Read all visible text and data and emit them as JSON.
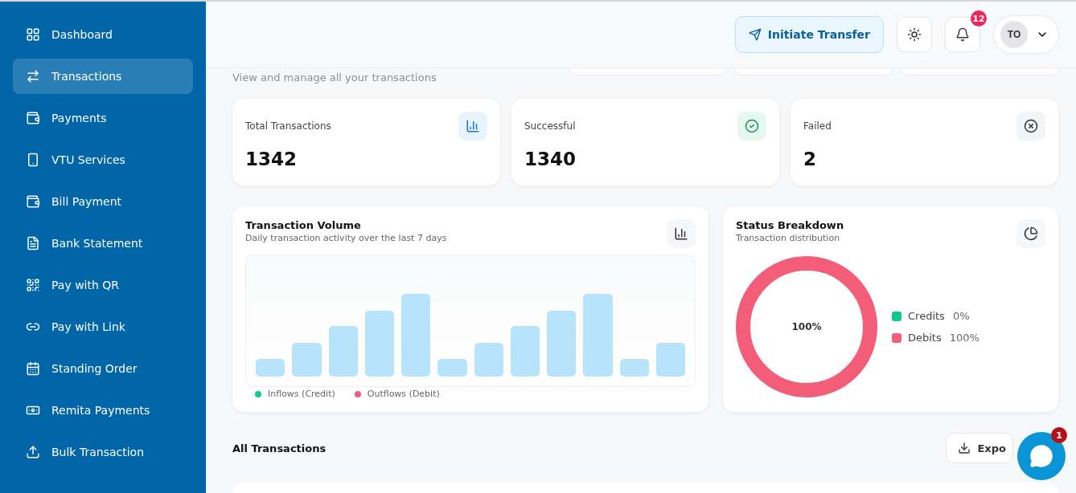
{
  "sidebar": {
    "items": [
      {
        "label": "Dashboard",
        "selected": false
      },
      {
        "label": "Transactions",
        "selected": true
      },
      {
        "label": "Payments",
        "selected": false
      },
      {
        "label": "VTU Services",
        "selected": false
      },
      {
        "label": "Bill Payment",
        "selected": false
      },
      {
        "label": "Bank Statement",
        "selected": false
      },
      {
        "label": "Pay with QR",
        "selected": false
      },
      {
        "label": "Pay with Link",
        "selected": false
      },
      {
        "label": "Standing Order",
        "selected": false
      },
      {
        "label": "Remita Payments",
        "selected": false
      },
      {
        "label": "Bulk Transaction",
        "selected": false
      }
    ]
  },
  "header": {
    "primary_button": "Initiate Transfer",
    "notifications_badge": "12",
    "avatar_initials": "TO"
  },
  "page": {
    "subtitle": "View and manage all your transactions"
  },
  "stats": [
    {
      "label": "Total Transactions",
      "value": "1342"
    },
    {
      "label": "Successful",
      "value": "1340"
    },
    {
      "label": "Failed",
      "value": "2"
    }
  ],
  "volume_card": {
    "title": "Transaction Volume",
    "subtitle": "Daily transaction activity over the last 7 days",
    "legend": [
      {
        "label": "Inflows (Credit)",
        "color": "#10c98a"
      },
      {
        "label": "Outflows (Debit)",
        "color": "#f45d78"
      }
    ]
  },
  "status_card": {
    "title": "Status Breakdown",
    "subtitle": "Transaction distribution",
    "center_label": "100%",
    "legend": [
      {
        "label": "Credits",
        "value": "0%",
        "color": "#10c98a"
      },
      {
        "label": "Debits",
        "value": "100%",
        "color": "#f45d78"
      }
    ]
  },
  "transactions": {
    "title": "All Transactions",
    "export_button": "Expo"
  },
  "chat": {
    "badge": "1"
  }
}
